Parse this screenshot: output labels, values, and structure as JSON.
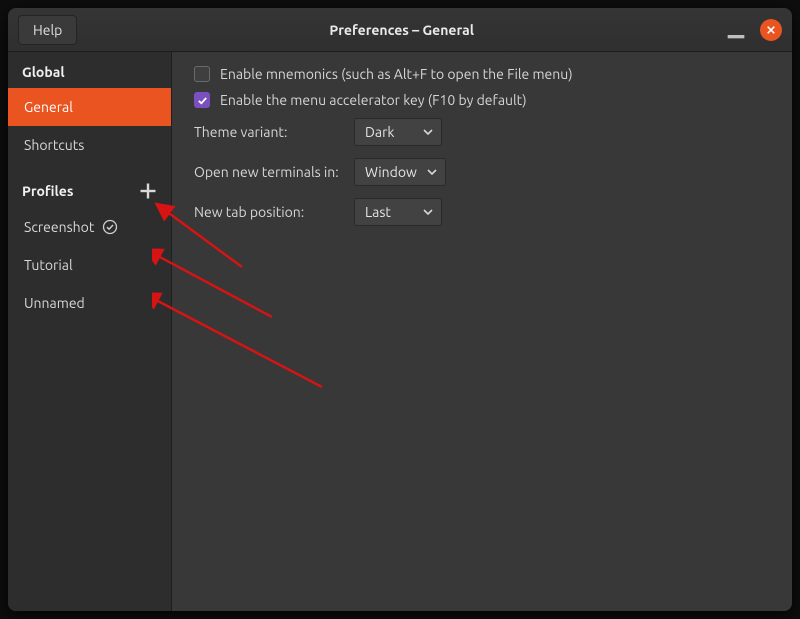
{
  "titlebar": {
    "help_label": "Help",
    "title": "Preferences – General"
  },
  "sidebar": {
    "section_global": "Global",
    "items_global": [
      {
        "label": "General",
        "selected": true
      },
      {
        "label": "Shortcuts",
        "selected": false
      }
    ],
    "section_profiles": "Profiles",
    "items_profiles": [
      {
        "label": "Screenshot",
        "default": true
      },
      {
        "label": "Tutorial",
        "default": false
      },
      {
        "label": "Unnamed",
        "default": false
      }
    ]
  },
  "general": {
    "mnemonics_label": "Enable mnemonics (such as Alt+F to open the File menu)",
    "mnemonics_checked": false,
    "accelerator_label": "Enable the menu accelerator key (F10 by default)",
    "accelerator_checked": true,
    "theme_variant_label": "Theme variant:",
    "theme_variant_value": "Dark",
    "open_new_label": "Open new terminals in:",
    "open_new_value": "Window",
    "new_tab_pos_label": "New tab position:",
    "new_tab_pos_value": "Last"
  },
  "colors": {
    "accent": "#e95420",
    "checkbox_fill": "#7a4fbf"
  }
}
